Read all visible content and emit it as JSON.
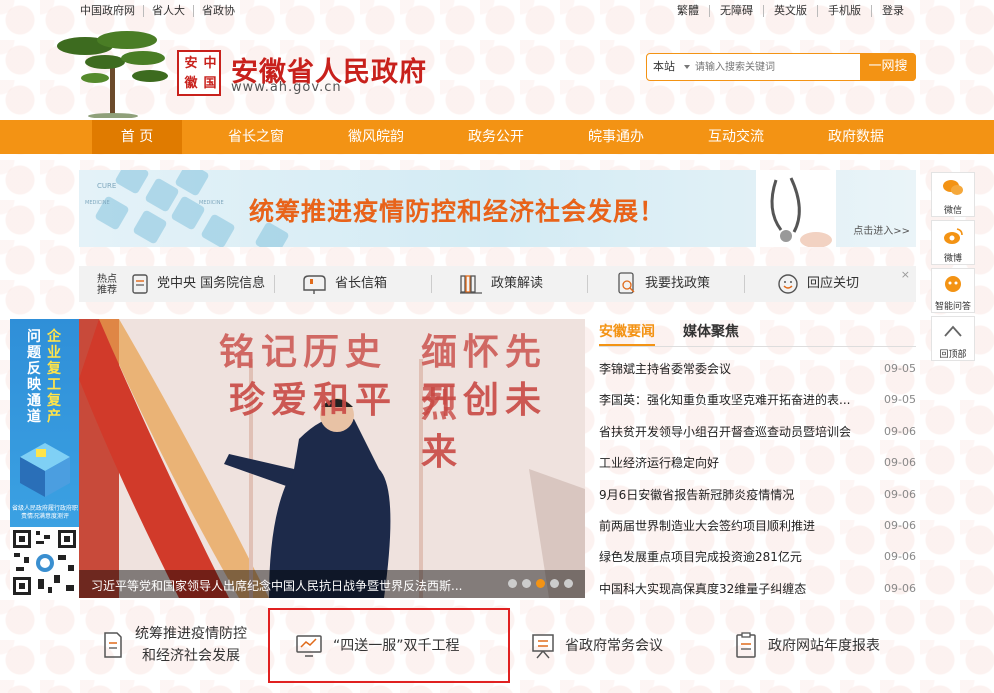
{
  "top_links_left": [
    "中国政府网",
    "省人大",
    "省政协"
  ],
  "top_links_right": [
    "繁體",
    "无障碍",
    "英文版",
    "手机版",
    "登录"
  ],
  "header": {
    "seal_chars": [
      "安",
      "中",
      "徽",
      "国"
    ],
    "title": "安徽省人民政府",
    "url": "www.ah.gov.cn"
  },
  "search": {
    "scope": "本站",
    "placeholder": "请输入搜索关键词",
    "button": "一网搜"
  },
  "nav": [
    "首 页",
    "省长之窗",
    "徽风皖韵",
    "政务公开",
    "皖事通办",
    "互动交流",
    "政府数据"
  ],
  "banner": {
    "text": "统筹推进疫情防控和经济社会发展！",
    "enter": "点击进入>>",
    "labels": [
      "CURE",
      "MEDICINE",
      "MEDICINE"
    ]
  },
  "quick_bar": {
    "label_line1": "热点",
    "label_line2": "推荐",
    "items": [
      "党中央 国务院信息",
      "省长信箱",
      "政策解读",
      "我要找政策",
      "回应关切"
    ],
    "close": "×"
  },
  "side_tools": [
    "微信",
    "微博",
    "智能问答",
    "回顶部"
  ],
  "promo": {
    "col1": "问题反映通道",
    "col2": "企业复工复产",
    "small_text": "省级人民政府履行政府职责情况满意度测评"
  },
  "photo": {
    "slogan_top_left": "铭记历史",
    "slogan_top_right": "缅怀先烈",
    "slogan_bottom_left": "珍爱和平",
    "slogan_bottom_right": "开创未来",
    "caption": "习近平等党和国家领导人出席纪念中国人民抗日战争暨世界反法西斯..."
  },
  "news": {
    "tabs": [
      "安徽要闻",
      "媒体聚焦"
    ],
    "items": [
      {
        "title": "李锦斌主持省委常委会议",
        "date": "09-05"
      },
      {
        "title": "李国英：强化知重负重攻坚克难开拓奋进的表...",
        "date": "09-05"
      },
      {
        "title": "省扶贫开发领导小组召开督查巡查动员暨培训会",
        "date": "09-06"
      },
      {
        "title": "工业经济运行稳定向好",
        "date": "09-06"
      },
      {
        "title": "9月6日安徽省报告新冠肺炎疫情情况",
        "date": "09-06"
      },
      {
        "title": "前两届世界制造业大会签约项目顺利推进",
        "date": "09-06"
      },
      {
        "title": "绿色发展重点项目完成投资逾281亿元",
        "date": "09-06"
      },
      {
        "title": "中国科大实现高保真度32维量子纠缠态",
        "date": "09-06"
      }
    ]
  },
  "features": {
    "f1_line1": "统筹推进疫情防控",
    "f1_line2": "和经济社会发展",
    "f2": "“四送一服”双千工程",
    "f3": "省政府常务会议",
    "f4": "政府网站年度报表"
  },
  "colors": {
    "accent": "#f39314",
    "brand_red": "#c8211c",
    "highlight": "#e02020"
  }
}
